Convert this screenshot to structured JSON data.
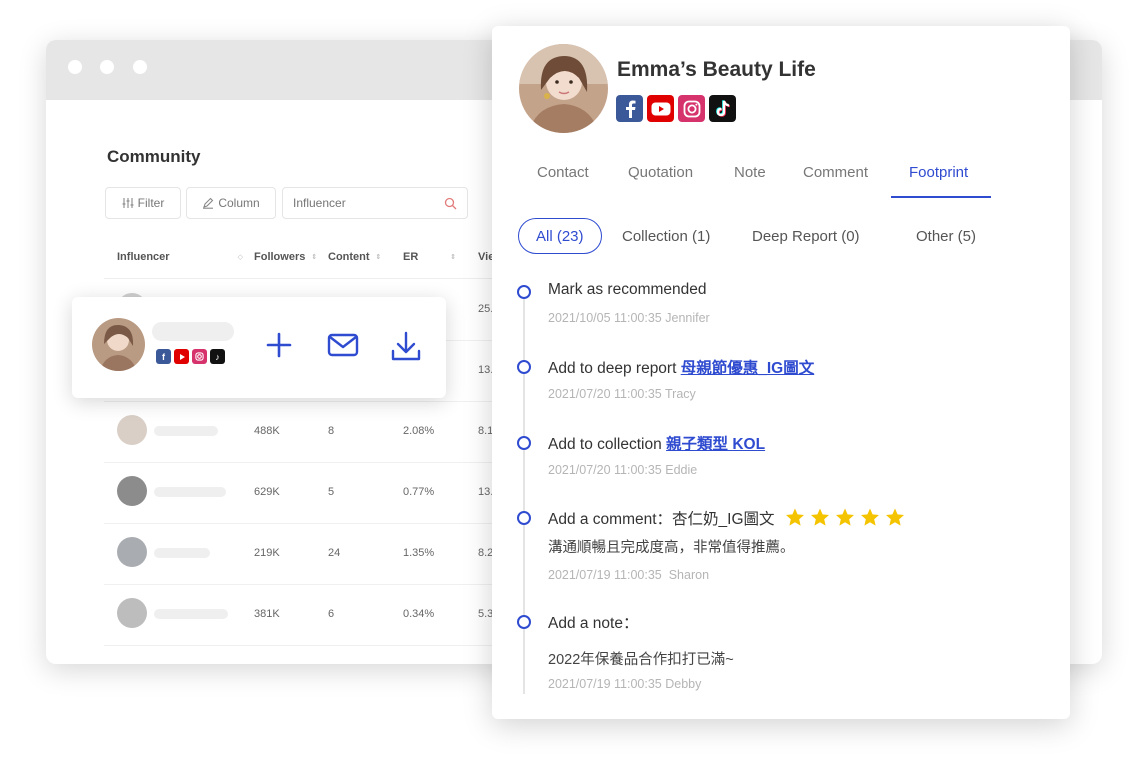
{
  "bg_window": {
    "title": "Community",
    "filter_label": "Filter",
    "column_label": "Column",
    "search_placeholder": "Influencer",
    "columns": [
      "Influencer",
      "Followers",
      "Content",
      "ER",
      "Vie"
    ],
    "rows": [
      {
        "followers": "",
        "content": "",
        "er": "",
        "views": "25."
      },
      {
        "followers": "",
        "content": "",
        "er": "",
        "views": "13."
      },
      {
        "followers": "488K",
        "content": "8",
        "er": "2.08%",
        "views": "8.1"
      },
      {
        "followers": "629K",
        "content": "5",
        "er": "0.77%",
        "views": "13."
      },
      {
        "followers": "219K",
        "content": "24",
        "er": "1.35%",
        "views": "8.2"
      },
      {
        "followers": "381K",
        "content": "6",
        "er": "0.34%",
        "views": "5.3"
      }
    ]
  },
  "action_card": {
    "actions": [
      "add-icon",
      "mail-icon",
      "download-icon"
    ]
  },
  "profile": {
    "name": "Emma’s Beauty Life",
    "socials": [
      "facebook-icon",
      "youtube-icon",
      "instagram-icon",
      "tiktok-icon"
    ]
  },
  "tabs": [
    {
      "label": "Contact",
      "active": false
    },
    {
      "label": "Quotation",
      "active": false
    },
    {
      "label": "Note",
      "active": false
    },
    {
      "label": "Comment",
      "active": false
    },
    {
      "label": "Footprint",
      "active": true
    }
  ],
  "filters": [
    {
      "label": "All (23)",
      "active": true
    },
    {
      "label": "Collection (1)",
      "active": false
    },
    {
      "label": "Deep Report (0)",
      "active": false
    },
    {
      "label": "Other (5)",
      "active": false
    }
  ],
  "timeline": [
    {
      "title": "Mark as recommended",
      "link": "",
      "detail": "",
      "date": "2021/10/05 11:00:35",
      "user": "Jennifer"
    },
    {
      "title": "Add to deep report ",
      "link": "母親節優惠_IG圖文",
      "detail": "",
      "date": "2021/07/20 11:00:35",
      "user": "Tracy"
    },
    {
      "title": "Add to collection ",
      "link": "親子類型 KOL",
      "detail": "",
      "date": "2021/07/20 11:00:35",
      "user": "Eddie"
    },
    {
      "title": "Add a comment：杏仁奶_IG圖文",
      "link": "",
      "rating": 5,
      "detail": "溝通順暢且完成度高，非常值得推薦。",
      "date": "2021/07/19 11:00:35",
      "user": "Sharon"
    },
    {
      "title": "Add a note：",
      "link": "",
      "detail": "2022年保養品合作扣打已滿~",
      "date": "2021/07/19 11:00:35",
      "user": "Debby"
    }
  ],
  "colors": {
    "accent": "#2f4bd0",
    "star": "#f5c400",
    "facebook": "#3b5998",
    "youtube": "#e00000",
    "instagram": "#d6336c",
    "tiktok": "#111111"
  }
}
